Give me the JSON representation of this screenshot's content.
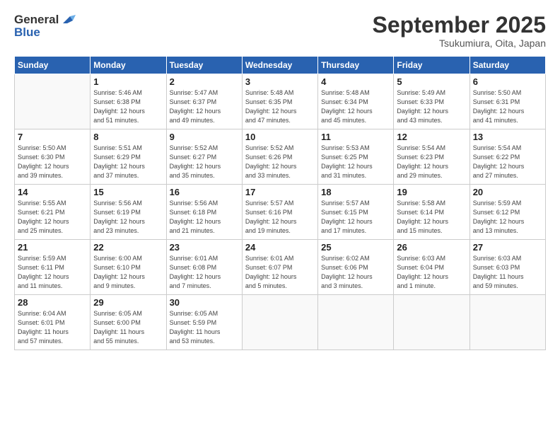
{
  "header": {
    "logo_line1": "General",
    "logo_line2": "Blue",
    "month": "September 2025",
    "location": "Tsukumiura, Oita, Japan"
  },
  "weekdays": [
    "Sunday",
    "Monday",
    "Tuesday",
    "Wednesday",
    "Thursday",
    "Friday",
    "Saturday"
  ],
  "weeks": [
    [
      {
        "day": "",
        "info": ""
      },
      {
        "day": "1",
        "info": "Sunrise: 5:46 AM\nSunset: 6:38 PM\nDaylight: 12 hours\nand 51 minutes."
      },
      {
        "day": "2",
        "info": "Sunrise: 5:47 AM\nSunset: 6:37 PM\nDaylight: 12 hours\nand 49 minutes."
      },
      {
        "day": "3",
        "info": "Sunrise: 5:48 AM\nSunset: 6:35 PM\nDaylight: 12 hours\nand 47 minutes."
      },
      {
        "day": "4",
        "info": "Sunrise: 5:48 AM\nSunset: 6:34 PM\nDaylight: 12 hours\nand 45 minutes."
      },
      {
        "day": "5",
        "info": "Sunrise: 5:49 AM\nSunset: 6:33 PM\nDaylight: 12 hours\nand 43 minutes."
      },
      {
        "day": "6",
        "info": "Sunrise: 5:50 AM\nSunset: 6:31 PM\nDaylight: 12 hours\nand 41 minutes."
      }
    ],
    [
      {
        "day": "7",
        "info": "Sunrise: 5:50 AM\nSunset: 6:30 PM\nDaylight: 12 hours\nand 39 minutes."
      },
      {
        "day": "8",
        "info": "Sunrise: 5:51 AM\nSunset: 6:29 PM\nDaylight: 12 hours\nand 37 minutes."
      },
      {
        "day": "9",
        "info": "Sunrise: 5:52 AM\nSunset: 6:27 PM\nDaylight: 12 hours\nand 35 minutes."
      },
      {
        "day": "10",
        "info": "Sunrise: 5:52 AM\nSunset: 6:26 PM\nDaylight: 12 hours\nand 33 minutes."
      },
      {
        "day": "11",
        "info": "Sunrise: 5:53 AM\nSunset: 6:25 PM\nDaylight: 12 hours\nand 31 minutes."
      },
      {
        "day": "12",
        "info": "Sunrise: 5:54 AM\nSunset: 6:23 PM\nDaylight: 12 hours\nand 29 minutes."
      },
      {
        "day": "13",
        "info": "Sunrise: 5:54 AM\nSunset: 6:22 PM\nDaylight: 12 hours\nand 27 minutes."
      }
    ],
    [
      {
        "day": "14",
        "info": "Sunrise: 5:55 AM\nSunset: 6:21 PM\nDaylight: 12 hours\nand 25 minutes."
      },
      {
        "day": "15",
        "info": "Sunrise: 5:56 AM\nSunset: 6:19 PM\nDaylight: 12 hours\nand 23 minutes."
      },
      {
        "day": "16",
        "info": "Sunrise: 5:56 AM\nSunset: 6:18 PM\nDaylight: 12 hours\nand 21 minutes."
      },
      {
        "day": "17",
        "info": "Sunrise: 5:57 AM\nSunset: 6:16 PM\nDaylight: 12 hours\nand 19 minutes."
      },
      {
        "day": "18",
        "info": "Sunrise: 5:57 AM\nSunset: 6:15 PM\nDaylight: 12 hours\nand 17 minutes."
      },
      {
        "day": "19",
        "info": "Sunrise: 5:58 AM\nSunset: 6:14 PM\nDaylight: 12 hours\nand 15 minutes."
      },
      {
        "day": "20",
        "info": "Sunrise: 5:59 AM\nSunset: 6:12 PM\nDaylight: 12 hours\nand 13 minutes."
      }
    ],
    [
      {
        "day": "21",
        "info": "Sunrise: 5:59 AM\nSunset: 6:11 PM\nDaylight: 12 hours\nand 11 minutes."
      },
      {
        "day": "22",
        "info": "Sunrise: 6:00 AM\nSunset: 6:10 PM\nDaylight: 12 hours\nand 9 minutes."
      },
      {
        "day": "23",
        "info": "Sunrise: 6:01 AM\nSunset: 6:08 PM\nDaylight: 12 hours\nand 7 minutes."
      },
      {
        "day": "24",
        "info": "Sunrise: 6:01 AM\nSunset: 6:07 PM\nDaylight: 12 hours\nand 5 minutes."
      },
      {
        "day": "25",
        "info": "Sunrise: 6:02 AM\nSunset: 6:06 PM\nDaylight: 12 hours\nand 3 minutes."
      },
      {
        "day": "26",
        "info": "Sunrise: 6:03 AM\nSunset: 6:04 PM\nDaylight: 12 hours\nand 1 minute."
      },
      {
        "day": "27",
        "info": "Sunrise: 6:03 AM\nSunset: 6:03 PM\nDaylight: 11 hours\nand 59 minutes."
      }
    ],
    [
      {
        "day": "28",
        "info": "Sunrise: 6:04 AM\nSunset: 6:01 PM\nDaylight: 11 hours\nand 57 minutes."
      },
      {
        "day": "29",
        "info": "Sunrise: 6:05 AM\nSunset: 6:00 PM\nDaylight: 11 hours\nand 55 minutes."
      },
      {
        "day": "30",
        "info": "Sunrise: 6:05 AM\nSunset: 5:59 PM\nDaylight: 11 hours\nand 53 minutes."
      },
      {
        "day": "",
        "info": ""
      },
      {
        "day": "",
        "info": ""
      },
      {
        "day": "",
        "info": ""
      },
      {
        "day": "",
        "info": ""
      }
    ]
  ]
}
